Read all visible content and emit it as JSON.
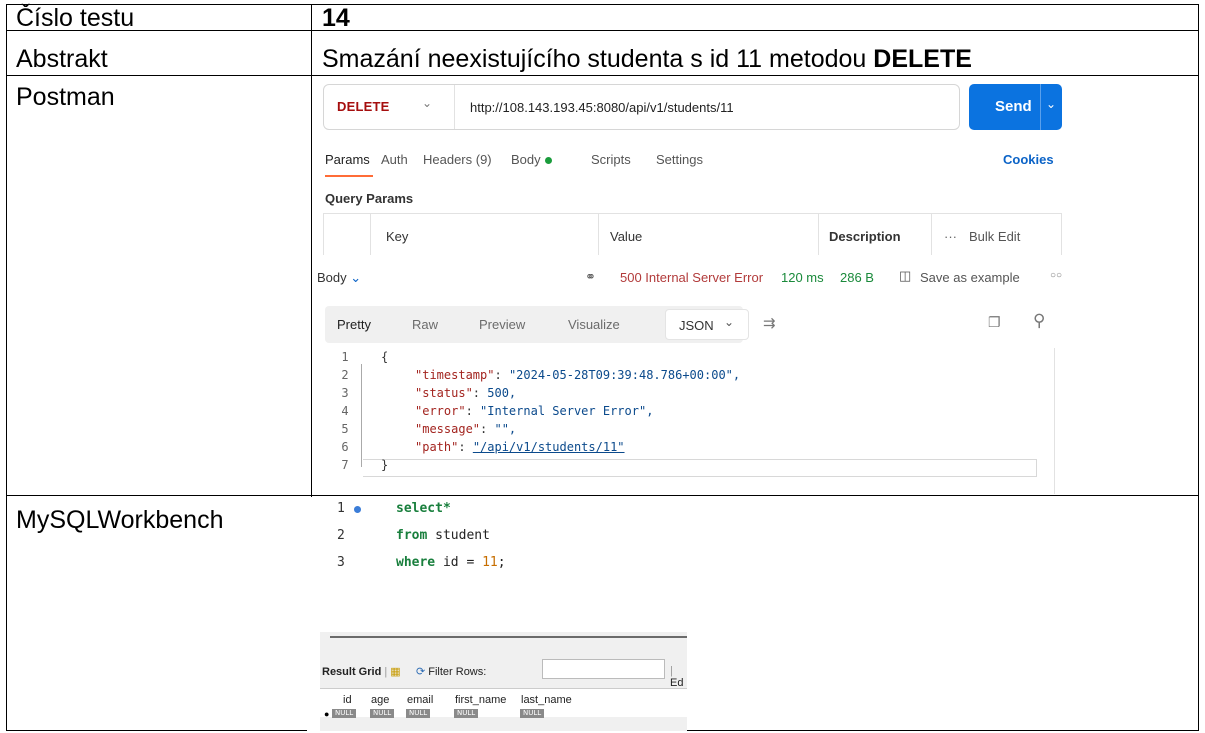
{
  "table": {
    "rows": [
      {
        "label": "Číslo testu",
        "value": "14"
      },
      {
        "label": "Abstrakt",
        "value_prefix": "Smazání neexistujícího studenta s id 11 metodou ",
        "value_bold": "DELETE"
      },
      {
        "label": "Postman"
      },
      {
        "label": "MySQLWorkbench"
      }
    ]
  },
  "postman": {
    "method": "DELETE",
    "url": "http://108.143.193.45:8080/api/v1/students/11",
    "send_label": "Send",
    "tabs": [
      "Params",
      "Auth",
      "Headers (9)",
      "Body",
      "Scripts",
      "Settings"
    ],
    "cookies_label": "Cookies",
    "query_params_label": "Query Params",
    "columns": [
      "Key",
      "Value",
      "Description"
    ],
    "bulk_edit_label": "Bulk Edit",
    "body_label": "Body",
    "status": "500 Internal Server Error",
    "time": "120 ms",
    "size": "286 B",
    "save_example_label": "Save as example",
    "view_tabs": [
      "Pretty",
      "Raw",
      "Preview",
      "Visualize"
    ],
    "format": "JSON",
    "code_lines": [
      {
        "n": "1",
        "text": "{"
      },
      {
        "n": "2",
        "key": "\"timestamp\"",
        "val": "\"2024-05-28T09:39:48.786+00:00\","
      },
      {
        "n": "3",
        "key": "\"status\"",
        "val": "500,"
      },
      {
        "n": "4",
        "key": "\"error\"",
        "val": "\"Internal Server Error\","
      },
      {
        "n": "5",
        "key": "\"message\"",
        "val": "\"\","
      },
      {
        "n": "6",
        "key": "\"path\"",
        "val": "\"/api/v1/students/11\""
      },
      {
        "n": "7",
        "text": "}"
      }
    ]
  },
  "mysql": {
    "lines": [
      {
        "n": "1",
        "kw": "select*"
      },
      {
        "n": "2",
        "kw": "from",
        "rest": " student"
      },
      {
        "n": "3",
        "kw": "where",
        "rest": " id = ",
        "num": "11",
        "end": ";"
      }
    ],
    "result_grid_label": "Result Grid",
    "filter_rows_label": "Filter Rows:",
    "edit_label": "Ed",
    "columns": [
      "id",
      "age",
      "email",
      "first_name",
      "last_name"
    ],
    "null_label": "NULL"
  }
}
